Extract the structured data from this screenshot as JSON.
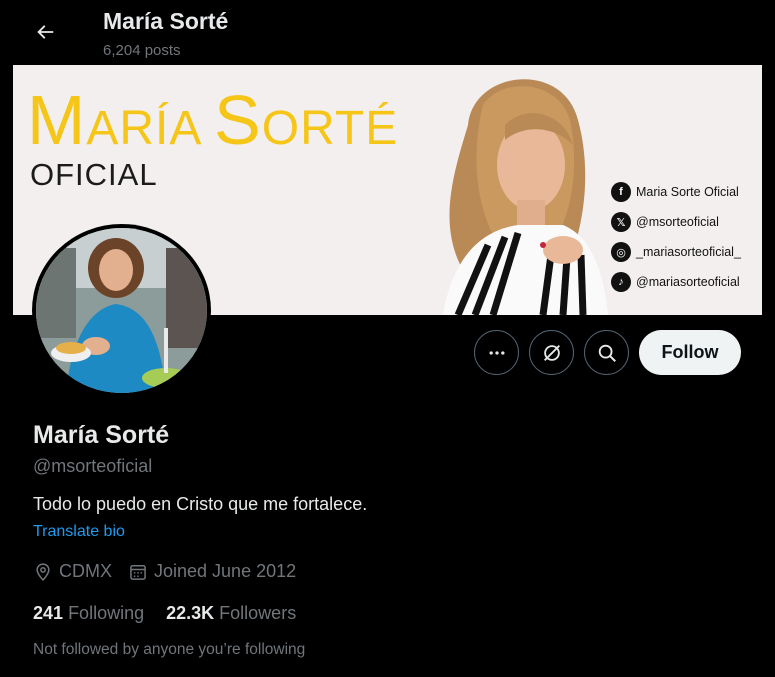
{
  "header": {
    "name": "María Sorté",
    "posts": "6,204 posts"
  },
  "banner": {
    "brand_main_first": "M",
    "brand_main_rest": "ARÍA ",
    "brand_main_s": "S",
    "brand_main_end": "ORTÉ",
    "brand_sub": "OFICIAL",
    "socials": [
      {
        "icon": "facebook-icon",
        "glyph": "f",
        "label": "Maria Sorte Oficial"
      },
      {
        "icon": "x-icon",
        "glyph": "𝕏",
        "label": "@msorteoficial"
      },
      {
        "icon": "instagram-icon",
        "glyph": "◎",
        "label": "_mariasorteoficial_"
      },
      {
        "icon": "tiktok-icon",
        "glyph": "♪",
        "label": "@mariasorteoficial"
      }
    ],
    "colors": {
      "background": "#f3efee",
      "brand": "#f5c518"
    }
  },
  "actions": {
    "follow_label": "Follow"
  },
  "profile": {
    "display_name": "María Sorté",
    "handle": "@msorteoficial",
    "bio": "Todo lo puedo en Cristo que me fortalece.",
    "translate_label": "Translate bio",
    "location": "CDMX",
    "joined": "Joined June 2012",
    "following_count": "241",
    "following_label": "Following",
    "followers_count": "22.3K",
    "followers_label": "Followers",
    "not_followed": "Not followed by anyone you’re following"
  }
}
